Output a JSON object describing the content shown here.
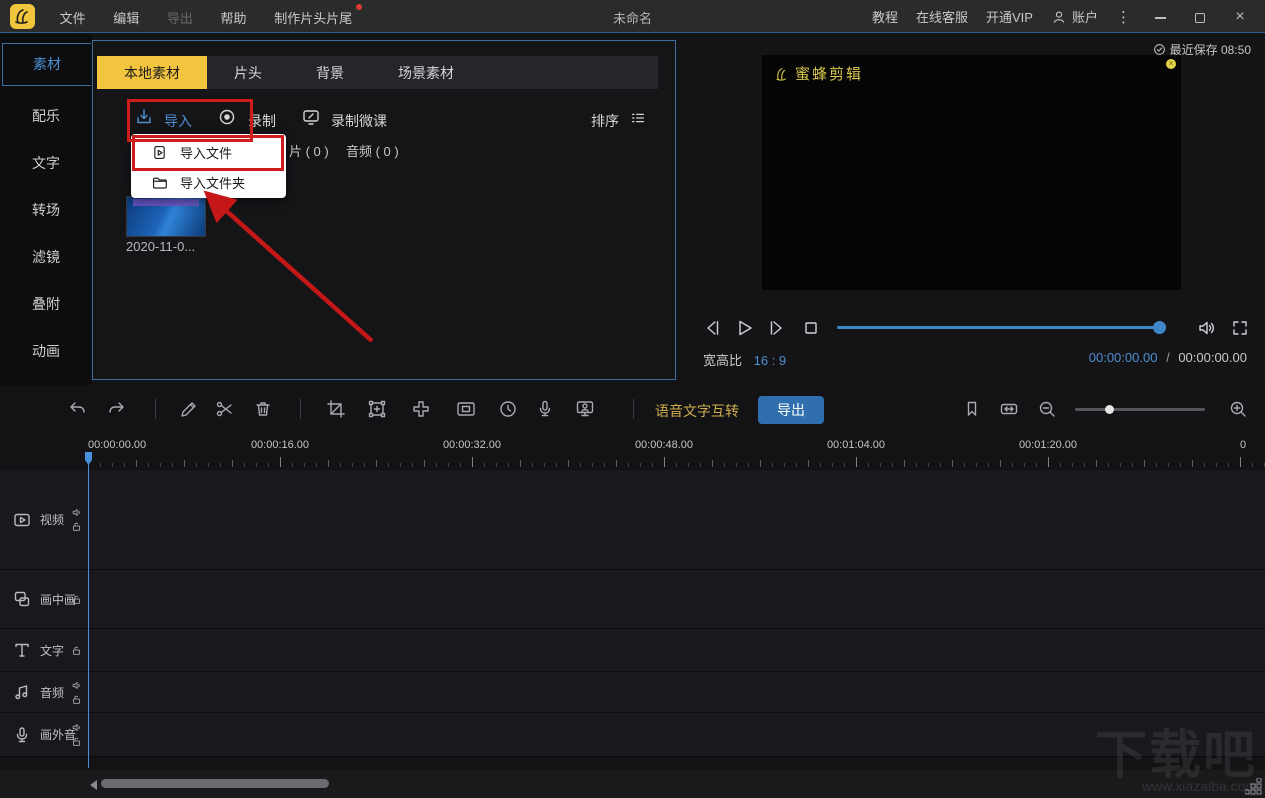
{
  "window": {
    "title": "未命名",
    "menus": [
      "文件",
      "编辑",
      "导出",
      "帮助",
      "制作片头片尾"
    ],
    "right": {
      "tutorial": "教程",
      "support": "在线客服",
      "vip": "开通VIP",
      "account": "账户"
    },
    "saved_status": "最近保存 08:50"
  },
  "sidebar": {
    "items": [
      {
        "label": "素材"
      },
      {
        "label": "配乐"
      },
      {
        "label": "文字"
      },
      {
        "label": "转场"
      },
      {
        "label": "滤镜"
      },
      {
        "label": "叠附"
      },
      {
        "label": "动画"
      }
    ]
  },
  "media": {
    "tabs": [
      {
        "label": "本地素材"
      },
      {
        "label": "片头"
      },
      {
        "label": "背景"
      },
      {
        "label": "场景素材"
      }
    ],
    "actions": {
      "import": "导入",
      "record": "录制",
      "record_lesson": "录制微课",
      "sort": "排序"
    },
    "counts": {
      "image_partial": "片 ( 0 )",
      "audio": "音频 ( 0 )"
    },
    "dropdown": {
      "items": [
        {
          "label": "导入文件"
        },
        {
          "label": "导入文件夹"
        }
      ]
    },
    "items": [
      {
        "name": "2020-11-0..."
      }
    ]
  },
  "preview": {
    "logo_text": "蜜蜂剪辑",
    "aspect_label": "宽高比",
    "aspect_value": "16 : 9",
    "current_time": "00:00:00.00",
    "time_separator": "/",
    "duration": "00:00:00.00"
  },
  "toolbar": {
    "speech_text": "语音文字互转",
    "export": "导出"
  },
  "timeline": {
    "ruler": [
      "00:00:00.00",
      "00:00:16.00",
      "00:00:32.00",
      "00:00:48.00",
      "00:01:04.00",
      "00:01:20.00",
      "0"
    ],
    "tracks": [
      {
        "label": "视频"
      },
      {
        "label": "画中画"
      },
      {
        "label": "文字"
      },
      {
        "label": "音频"
      },
      {
        "label": "画外音"
      }
    ]
  },
  "site_watermark": {
    "title": "下载吧",
    "url": "www.xiazaiba.com"
  },
  "colors": {
    "accent_blue": "#4f8ed0",
    "tab_yellow": "#f3c53f",
    "vip_orange": "#e8a23c",
    "annotation_red": "#cf1d1d",
    "export_button": "#2f6fad",
    "playhead": "#4a8fdc"
  }
}
